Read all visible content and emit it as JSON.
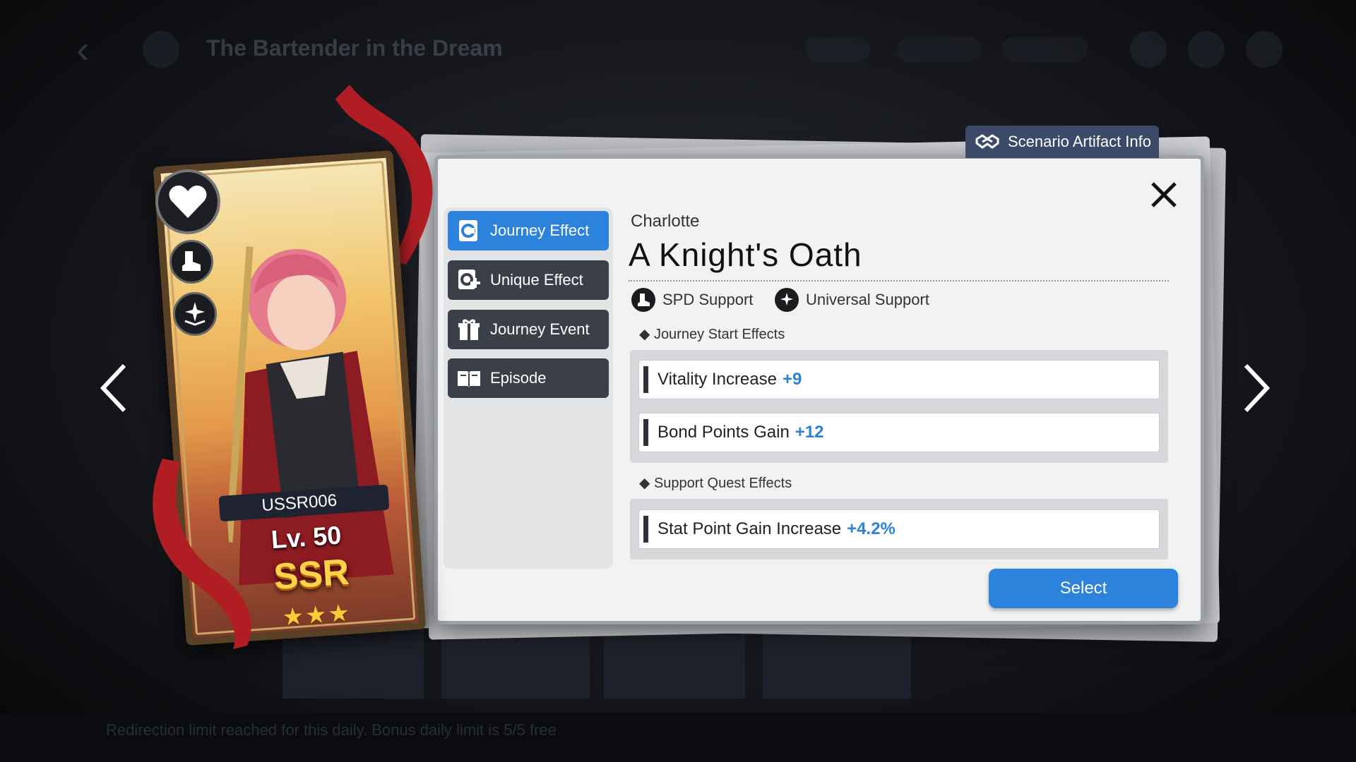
{
  "background": {
    "title": "The Bartender in the Dream",
    "footer_text": "Redirection limit reached for this daily. Bonus daily limit is 5/5 free",
    "colors": {
      "backdrop": "#15171c"
    }
  },
  "panel_tag": {
    "label": "Scenario Artifact Info",
    "icon": "handshake-icon"
  },
  "menu": {
    "items": [
      {
        "label": "Journey Effect",
        "icon": "card-icon",
        "active": true
      },
      {
        "label": "Unique Effect",
        "icon": "card-plus-icon",
        "active": false
      },
      {
        "label": "Journey Event",
        "icon": "gift-icon",
        "active": false
      },
      {
        "label": "Episode",
        "icon": "book-icon",
        "active": false
      }
    ]
  },
  "card_info": {
    "character": "Charlotte",
    "title": "A Knight's Oath",
    "roles": [
      {
        "label": "SPD Support",
        "icon": "boot-icon"
      },
      {
        "label": "Universal Support",
        "icon": "star-book-icon"
      }
    ]
  },
  "effects": {
    "journey_start": {
      "heading": "Journey Start Effects",
      "rows": [
        {
          "label": "Vitality Increase",
          "value": "+9"
        },
        {
          "label": "Bond Points Gain",
          "value": "+12"
        }
      ]
    },
    "support_quest": {
      "heading": "Support Quest Effects",
      "rows": [
        {
          "label": "Stat Point Gain Increase",
          "value": "+4.2%"
        }
      ]
    }
  },
  "select_label": "Select",
  "card": {
    "id": "USSR006",
    "level": "Lv. 50",
    "rarity": "SSR",
    "stars": "★★★",
    "colors": {
      "frame": "#5a4126",
      "accent": "#2d83dc",
      "ribbon": "#b01e24"
    }
  }
}
